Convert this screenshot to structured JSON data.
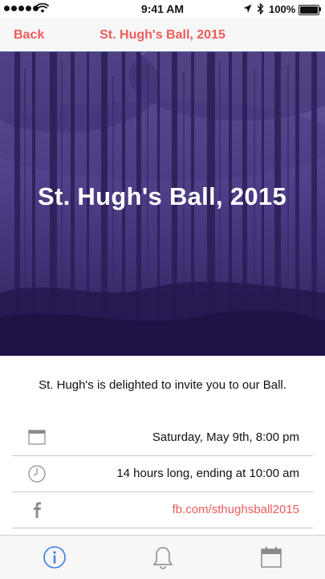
{
  "status_bar": {
    "time": "9:41 AM",
    "battery": "100%"
  },
  "nav": {
    "back_label": "Back",
    "title": "St. Hugh's Ball, 2015"
  },
  "hero": {
    "title": "St. Hugh's Ball, 2015"
  },
  "content": {
    "invite_text": "St. Hugh's is delighted to invite you to our Ball.",
    "rows": [
      {
        "icon": "calendar-icon",
        "text": "Saturday, May 9th, 8:00 pm"
      },
      {
        "icon": "clock-icon",
        "text": "14 hours long, ending at 10:00 am"
      },
      {
        "icon": "facebook-icon",
        "text": "fb.com/sthughsball2015"
      }
    ]
  },
  "tab_bar": {
    "tabs": [
      {
        "icon": "info-icon",
        "selected": true
      },
      {
        "icon": "bell-icon",
        "selected": false
      },
      {
        "icon": "calendar-icon",
        "selected": false
      }
    ]
  },
  "colors": {
    "accent": "#ee5b5b",
    "tab_selected": "#3a7cf0",
    "hero_tint": "#3e2a72"
  }
}
